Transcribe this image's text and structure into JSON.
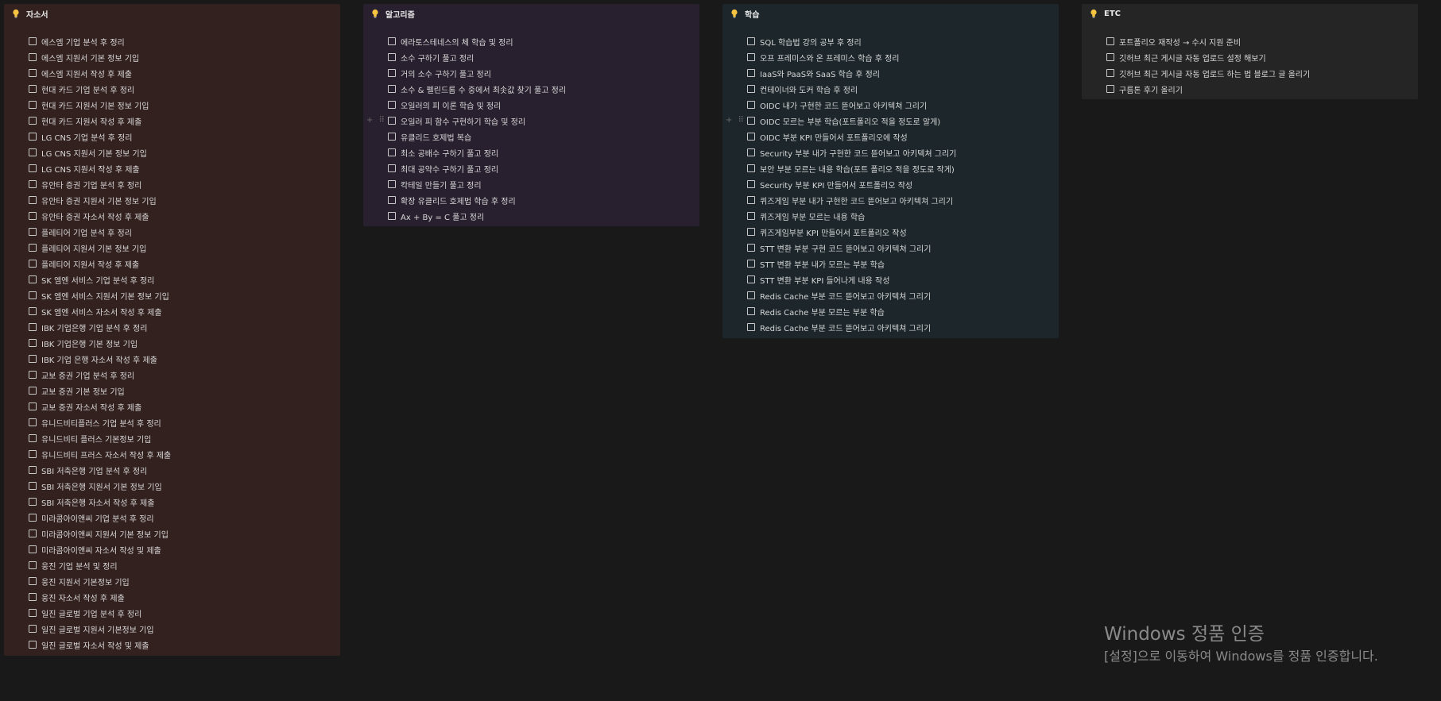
{
  "columns": [
    {
      "title": "자소서",
      "bg": "#33211f",
      "icon": "lightbulb-icon",
      "items": [
        "에스엠 기업 분석 후 정리",
        "에스엠 지원서 기본 정보 기입",
        "에스엠 지원서 작성 후 제출",
        "현대 카드 기업 분석 후 정리",
        "현대 카드 지원서 기본 정보 기입",
        "현대 카드 지원서 작성 후 제출",
        "LG CNS 기업 분석 후 정리",
        "LG CNS 지원서 기본 정보 기입",
        "LG CNS 지원서 작성 후 제출",
        "유안타 증권 기업 분석 후 정리",
        "유안타 증권 지원서 기본 정보 기입",
        "유안타 증권 자소서 작성 후 제출",
        "플레티어 기업 분석 후 정리",
        "플레티어 지원서 기본 정보 기입",
        "플레티어 지원서 작성 후 제출",
        "SK 엠엔 서비스 기업 분석 후 정리",
        "SK 엠엔 서비스 지원서 기본 정보 기입",
        "SK 엠엔 서비스 자소서 작성 후 제출",
        "IBK 기업은행 기업 분석 후 정리",
        "IBK 기업은행 기본 정보 기입",
        "IBK 기업 은행 자소서 작성 후 제출",
        "교보 증권 기업 분석 후 정리",
        "교보 증권 기본 정보 기입",
        "교보 증권 자소서 작성 후 제출",
        "유니드비티플러스 기업 분석 후 정리",
        "유니드비티 플러스 기본정보 기입",
        "유니드비티 프러스 자소서 작성 후 제출",
        "SBI 저축은행 기업 분석 후 정리",
        "SBI 저축은행 지원서 기본 정보 기입",
        "SBI 저축은행 자소서 작성 후 제출",
        "미라콤아이앤씨 기업 분석 후 정리",
        "미라콤아이앤씨 지원서 기본 정보 기입",
        "미라콤아이앤씨 자소서 작성 및 제출",
        "웅진 기업 분석 및 정리",
        "웅진 지원서 기본정보 기입",
        "웅진 자소서 작성 후 제출",
        "일진 글로벌 기업 분석 후 정리",
        "일진 글로벌 지원서 기본정보 기입",
        "일진 글로벌 자소서 작성 및 제출"
      ]
    },
    {
      "title": "알고리즘",
      "bg": "#29202f",
      "icon": "lightbulb-icon",
      "items": [
        "에라토스테네스의 체 학습 및 정리",
        "소수 구하기 풀고 정리",
        "거의 소수 구하기 풀고 정리",
        "소수 & 펠린드롬 수 중에서 최솟값 찾기 풀고 정리",
        "오일러의 피 이론 학습 및 정리",
        "오일러 피 함수 구현하기 학습 및 정리",
        "유클리드 호제법 복습",
        "최소 공배수 구하기 풀고 정리",
        "최대 공약수 구하기 풀고 정리",
        "칵테일 만들기 풀고 정리",
        "확장 유클리드 호제법 학습 후 정리",
        "Ax + By = C 풀고 정리"
      ],
      "handle_row": 5
    },
    {
      "title": "학습",
      "bg": "#1c262b",
      "icon": "lightbulb-icon",
      "items": [
        "SQL 학습법 강의 공부 후 정리",
        "오프 프레미스와 온 프레미스 학습 후 정리",
        "IaaS와 PaaS와 SaaS 학습 후 정리",
        "컨테이너와 도커 학습 후 정리",
        "OIDC 내가 구현한 코드 뜯어보고 아키텍쳐 그리기",
        "OIDC 모르는 부분 학습(포트폴리오 적을 정도로 알게)",
        "OIDC 부분 KPI 만들어서 포트폴리오에 작성",
        "Security 부분 내가 구현한 코드 뜯어보고 아키텍쳐 그리기",
        "보안 부분 모르는 내용 학습(포트 폴리오 적을 정도로 작게)",
        "Security 부분 KPI 만들어서 포트폴리오 작성",
        "퀴즈게임 부분 내가 구현한 코드 뜯어보고 아키텍쳐 그리기",
        "퀴즈게임 부분 모르는 내용 학습",
        "퀴즈게임부분 KPI 만들어서 포트폴리오 작성",
        "STT 변환 부분 구현 코드 뜯어보고 아키텍쳐 그리기",
        "STT 변환 부분 내가 모르는 부분 학습",
        "STT 변환 부분 KPI 들어나게 내용 작성",
        "Redis Cache 부분 코드 뜯어보고 아키텍쳐 그리기",
        "Redis Cache 부분 모르는 부분 학습",
        "Redis Cache 부분 코드 뜯어보고 아키텍쳐 그리기"
      ],
      "handle_row": 5
    },
    {
      "title": "ETC",
      "bg": "#252525",
      "icon": "lightbulb-icon",
      "items": [
        "포트폴리오 재작성 → 수시 지원 준비",
        "깃허브 최근 게시글 자동 업로드 설정 해보기",
        "깃허브 최근 게시글 자동 업로드 하는 법 블로그 글 올리기",
        "구름톤 후기 올리기"
      ]
    }
  ],
  "handle_glyphs": "+ ⠿",
  "activation": {
    "title": "Windows 정품 인증",
    "subtitle": "[설정]으로 이동하여 Windows를 정품 인증합니다."
  }
}
